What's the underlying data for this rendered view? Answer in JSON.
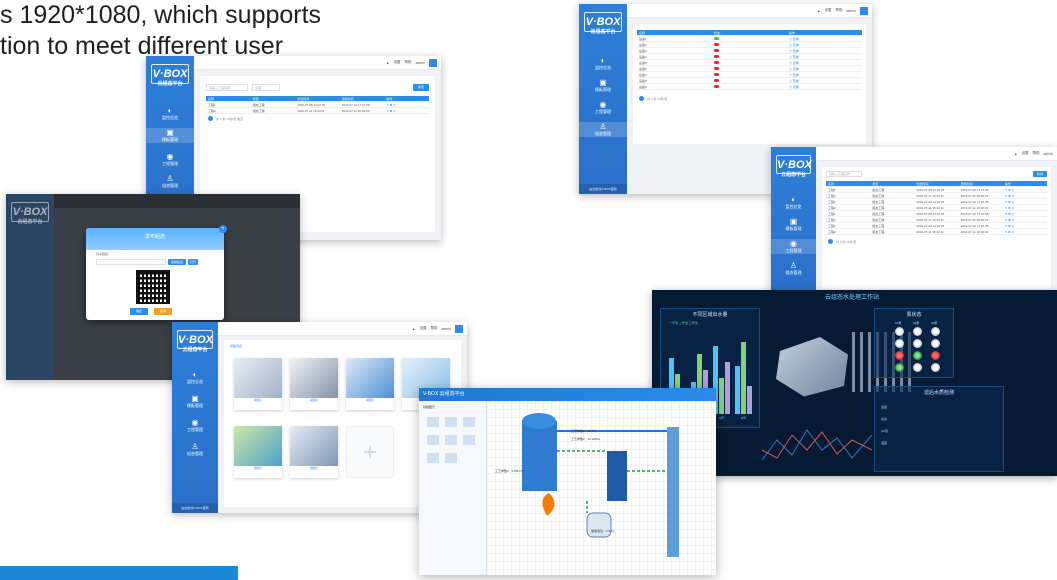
{
  "hero_text": {
    "line1": "s 1920*1080, which supports",
    "line2": "tion to meet different user"
  },
  "brand": {
    "logo_text": "V·BOX",
    "platform_name": "云组态平台",
    "footer": "由此前往V-BOX官网"
  },
  "topbar": {
    "setting": "设置",
    "help": "帮助",
    "user": "admin"
  },
  "nav": [
    {
      "icon": "gauge-icon",
      "label": "监控总览"
    },
    {
      "icon": "dashboard-icon",
      "label": "模板管理"
    },
    {
      "icon": "globe-icon",
      "label": "工程管理"
    },
    {
      "icon": "user-icon",
      "label": "组态管理"
    }
  ],
  "list_window": {
    "search_placeholder": "请输入工程名称",
    "filter_label": "全部",
    "add_button": "新增",
    "columns": [
      "名称",
      "类型",
      "创建时间",
      "更新时间",
      "操作"
    ],
    "rows": [
      {
        "name": "工程1",
        "type": "组态工程",
        "created": "2019-07-08 14:22:35",
        "updated": "2019-07-10 17:21:08"
      },
      {
        "name": "工程2",
        "type": "组态工程",
        "created": "2019-07-11 15:10:11",
        "updated": "2019-07-11 16:02:03"
      }
    ],
    "pager": "共 2 条  10条/页  跳至"
  },
  "status_window": {
    "columns": [
      "名称",
      "状态",
      "操作"
    ],
    "rows": [
      {
        "name": "设备1",
        "status": "在线"
      },
      {
        "name": "设备2",
        "status": "离线"
      },
      {
        "name": "设备3",
        "status": "离线"
      },
      {
        "name": "设备4",
        "status": "离线"
      },
      {
        "name": "设备5",
        "status": "离线"
      },
      {
        "name": "设备6",
        "status": "离线"
      },
      {
        "name": "设备7",
        "status": "离线"
      },
      {
        "name": "设备8",
        "status": "离线"
      },
      {
        "name": "设备9",
        "status": "离线"
      }
    ],
    "pager": "共 9 条  10条/页"
  },
  "modal": {
    "title": "发布组态",
    "share_label": "分享链接",
    "copy_button": "复制链接",
    "open_button": "打开",
    "confirm": "确定",
    "cancel": "取消"
  },
  "template_window": {
    "tab_label": "模板列表",
    "cards": [
      "模板1",
      "模板2",
      "模板3",
      "模板4",
      "模板5",
      "模板6"
    ],
    "add_symbol": "+"
  },
  "process_window": {
    "title": "V-BOX 云组态平台",
    "palette_title": "基础图元",
    "labels": [
      "工艺参数1：35.6℃",
      "工艺参数2：12.4MPa",
      "工艺参数3：0.85m³/h",
      "储罐液位：2.36m"
    ]
  },
  "dashboard": {
    "title": "云组态水处理工作站",
    "left_title": "不同区域出水量",
    "right_title": "泵状态",
    "bottom_title": "滤后水质检测",
    "legend": [
      "一号池",
      "二号池",
      "三号池"
    ],
    "chart_data": {
      "type": "bar",
      "categories": [
        "A区",
        "B区",
        "C区",
        "D区"
      ],
      "series": [
        {
          "name": "一号池",
          "values": [
            70,
            40,
            85,
            60
          ]
        },
        {
          "name": "二号池",
          "values": [
            50,
            75,
            45,
            90
          ]
        },
        {
          "name": "三号池",
          "values": [
            30,
            55,
            65,
            35
          ]
        }
      ],
      "ylim": [
        0,
        100
      ]
    },
    "pump_labels": [
      "1#泵",
      "2#泵",
      "3#泵"
    ],
    "table_rows": [
      "浊度",
      "余氯",
      "pH值",
      "温度"
    ]
  }
}
